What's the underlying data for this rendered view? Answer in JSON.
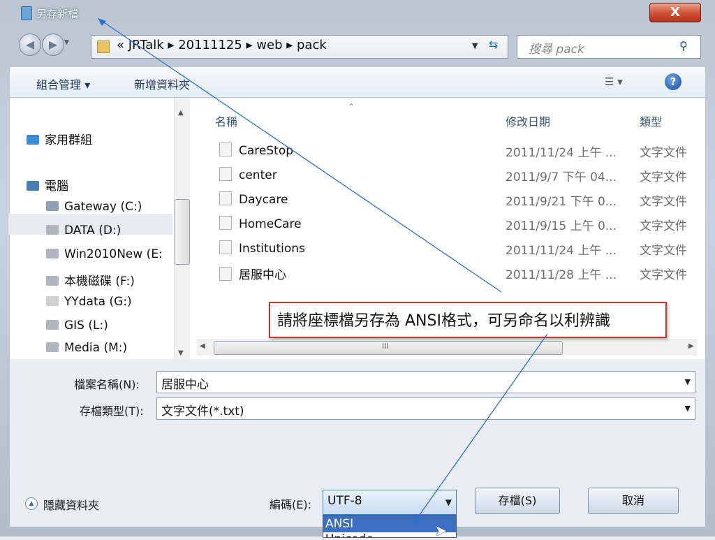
{
  "window": {
    "title": "另存新檔",
    "close_label": "X"
  },
  "address": {
    "breadcrumb": "« JRTalk ▸ 20111125 ▸ web ▸ pack",
    "search_placeholder": "搜尋 pack"
  },
  "toolbar": {
    "organize": "組合管理 ▾",
    "new_folder": "新增資料夾",
    "help": "?"
  },
  "nav": {
    "items": [
      {
        "label": "家用群組",
        "icon": "homegroup-icon",
        "color": "#3a8fd8"
      },
      {
        "label": "電腦",
        "icon": "computer-icon",
        "color": "#4a7db8"
      },
      {
        "label": "Gateway (C:)",
        "icon": "windows-drive-icon",
        "color": "#8fa0b3"
      },
      {
        "label": "DATA (D:)",
        "icon": "drive-icon",
        "color": "#b0b6bd"
      },
      {
        "label": "Win2010New (E:",
        "icon": "drive-icon",
        "color": "#b0b6bd"
      },
      {
        "label": "本機磁碟 (F:)",
        "icon": "drive-icon",
        "color": "#b0b6bd"
      },
      {
        "label": "YYdata (G:)",
        "icon": "network-drive-icon",
        "color": "#d0d0d0"
      },
      {
        "label": "GIS (L:)",
        "icon": "drive-icon",
        "color": "#b0b6bd"
      },
      {
        "label": "Media (M:)",
        "icon": "drive-icon",
        "color": "#b0b6bd"
      }
    ]
  },
  "files": {
    "headers": {
      "name": "名稱",
      "modified": "修改日期",
      "type": "類型"
    },
    "rows": [
      {
        "name": "CareStop",
        "modified": "2011/11/24 上午 ...",
        "type": "文字文件"
      },
      {
        "name": "center",
        "modified": "2011/9/7 下午 04...",
        "type": "文字文件"
      },
      {
        "name": "Daycare",
        "modified": "2011/9/21 下午 0...",
        "type": "文字文件"
      },
      {
        "name": "HomeCare",
        "modified": "2011/9/15 上午 0...",
        "type": "文字文件"
      },
      {
        "name": "Institutions",
        "modified": "2011/11/24 上午 ...",
        "type": "文字文件"
      },
      {
        "name": "居服中心",
        "modified": "2011/11/28 上午 ...",
        "type": "文字文件"
      }
    ],
    "hscroll_grip": "III"
  },
  "callout": {
    "text": "請將座標檔另存為 ANSI格式，可另命名以利辨識"
  },
  "form": {
    "filename_label": "檔案名稱(N):",
    "filename_value": "居服中心",
    "filetype_label": "存檔類型(T):",
    "filetype_value": "文字文件(*.txt)",
    "hide_folders": "隱藏資料夾",
    "encoding_label": "編碼(E):",
    "encoding_value": "UTF-8",
    "encoding_options": [
      "ANSI",
      "Unicode"
    ],
    "save": "存檔(S)",
    "cancel": "取消"
  },
  "colors": {
    "accent": "#3a6fc4",
    "callout_border": "#c0392b",
    "annotation_line": "#2f6fd0"
  }
}
